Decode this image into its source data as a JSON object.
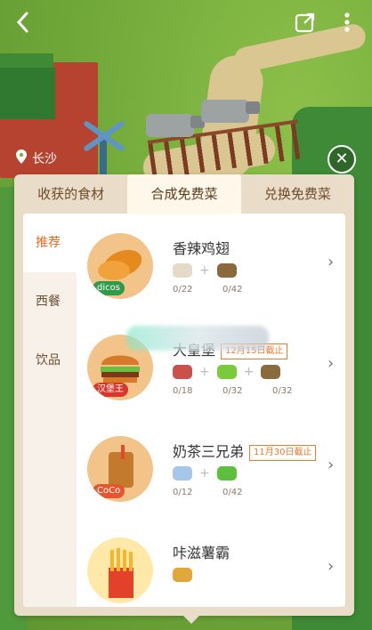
{
  "topbar": {
    "back_icon": "back-icon",
    "share_icon": "share-icon",
    "more_icon": "more-icon"
  },
  "location": "长沙",
  "close_icon": "close-icon",
  "tabs": [
    {
      "label": "收获的食材",
      "active": false
    },
    {
      "label": "合成免费菜",
      "active": true
    },
    {
      "label": "兑换免费菜",
      "active": false
    }
  ],
  "categories": [
    {
      "label": "推荐",
      "active": true
    },
    {
      "label": "西餐",
      "active": false
    },
    {
      "label": "饮品",
      "active": false
    }
  ],
  "items": [
    {
      "title": "香辣鸡翅",
      "brand": "dicos",
      "deadline": "",
      "counts": [
        "0/22",
        "0/42"
      ],
      "ingredient_icons": [
        "garlic-icon",
        "bag-icon"
      ]
    },
    {
      "title": "大皇堡",
      "brand": "汉堡王",
      "deadline": "12月15日截止",
      "counts": [
        "0/18",
        "0/32",
        "0/32"
      ],
      "ingredient_icons": [
        "meat-icon",
        "lettuce-icon",
        "bag-icon"
      ]
    },
    {
      "title": "奶茶三兄弟",
      "brand": "CoCo",
      "deadline": "11月30日截止",
      "counts": [
        "0/12",
        "0/42"
      ],
      "ingredient_icons": [
        "milk-icon",
        "tea-leaf-icon"
      ]
    },
    {
      "title": "咔滋薯霸",
      "brand": "",
      "deadline": "",
      "counts": [],
      "ingredient_icons": [
        "potato-icon"
      ]
    }
  ],
  "colors": {
    "accent": "#f0671e",
    "panel": "#e9dcc9",
    "tab_active": "#fff7ea"
  }
}
